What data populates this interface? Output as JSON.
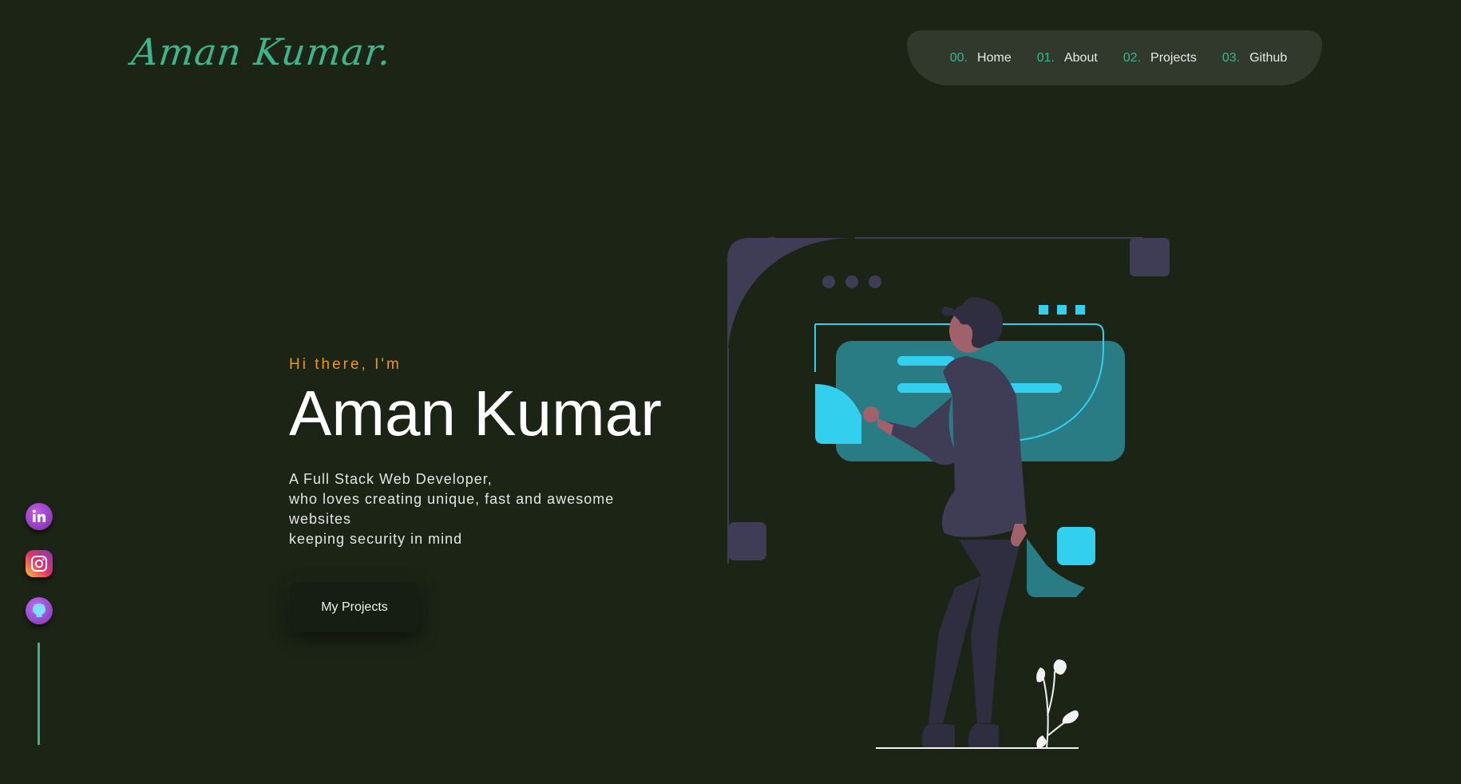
{
  "logo": {
    "text": "Aman Kumar."
  },
  "nav": {
    "items": [
      {
        "num": "00.",
        "label": "Home"
      },
      {
        "num": "01.",
        "label": "About"
      },
      {
        "num": "02.",
        "label": "Projects"
      },
      {
        "num": "03.",
        "label": "Github"
      }
    ]
  },
  "hero": {
    "greeting": "Hi there, I'm",
    "name": "Aman Kumar",
    "tagline": [
      "A Full Stack Web Developer,",
      "who loves creating unique, fast and awesome websites",
      "keeping security in mind"
    ],
    "cta_label": "My Projects"
  },
  "social": {
    "items": [
      {
        "icon": "linkedin-icon"
      },
      {
        "icon": "instagram-icon"
      },
      {
        "icon": "github-icon"
      }
    ]
  },
  "colors": {
    "background": "#1c2416",
    "accent": "#3fb38c",
    "greeting": "#f0961a",
    "nav_bg": "#30392b",
    "illustration_teal": "#2a7c84",
    "illustration_cyan": "#33cfee",
    "illustration_purple": "#3f3d56"
  }
}
